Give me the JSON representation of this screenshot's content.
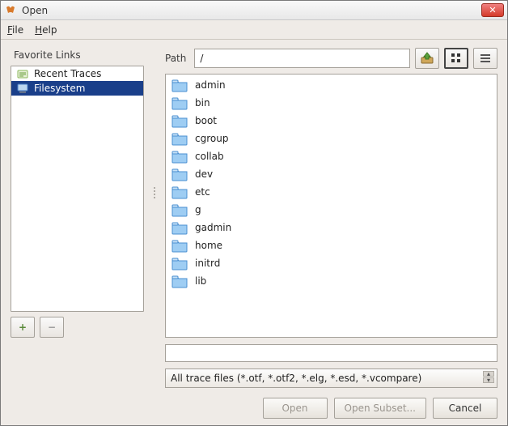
{
  "window": {
    "title": "Open"
  },
  "menu": {
    "file": "File",
    "help": "Help"
  },
  "left": {
    "heading": "Favorite Links",
    "items": [
      {
        "label": "Recent Traces",
        "selected": false
      },
      {
        "label": "Filesystem",
        "selected": true
      }
    ],
    "add_tip": "+",
    "remove_tip": "−"
  },
  "path": {
    "label": "Path",
    "value": "/"
  },
  "toolbar": {
    "up_tip": "up",
    "icons_tip": "icons",
    "list_tip": "list"
  },
  "files": [
    "admin",
    "bin",
    "boot",
    "cgroup",
    "collab",
    "dev",
    "etc",
    "g",
    "gadmin",
    "home",
    "initrd",
    "lib"
  ],
  "filename": {
    "value": ""
  },
  "filter": {
    "selected": "All trace files (*.otf, *.otf2, *.elg, *.esd, *.vcompare)"
  },
  "actions": {
    "open": "Open",
    "open_subset": "Open Subset...",
    "cancel": "Cancel"
  },
  "colors": {
    "selection": "#1a3f8a",
    "folder": "#7ab7ef"
  }
}
